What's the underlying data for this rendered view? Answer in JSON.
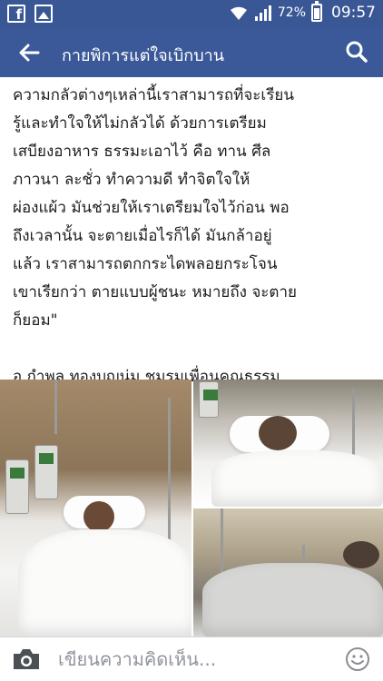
{
  "status_bar": {
    "battery_text": "72%",
    "time": "09:57",
    "icons": [
      "facebook-icon",
      "image-icon",
      "wifi-icon",
      "signal-icon",
      "battery-icon"
    ]
  },
  "app_bar": {
    "title": "กายพิการแต่ใจเบิกบาน",
    "back_icon": "arrow-left-icon",
    "search_icon": "search-icon",
    "color": "#3b5998"
  },
  "post": {
    "lines": [
      "ความกลัวต่างๆเหล่านี้เราสามารถที่จะเรียน",
      "รู้และทำใจให้ไม่กลัวได้ ด้วยการเตรียม",
      "เสบียงอาหาร ธรรมะเอาไว้ คือ ทาน ศีล",
      "ภาวนา ละชั่ว ทำความดี ทำจิตใจให้",
      "ผ่องแผ้ว มันช่วยให้เราเตรียมใจไว้ก่อน พอ",
      "ถึงเวลานั้น จะตายเมื่อไรก็ได้ มันกล้าอยู่",
      "แล้ว เราสามารถตกกระไดพลอยกระโจน",
      "เขาเรียกว่า ตายแบบผู้ชนะ หมายถึง จะตาย",
      "ก็ยอม\""
    ],
    "signature": "อ.กำพล ทองบุญนุ่ม ชมรมเพื่อนคุณธรรม"
  },
  "comment_bar": {
    "placeholder": "เขียนความคิดเห็น...",
    "camera_icon": "camera-icon",
    "emoji_icon": "smiley-icon"
  }
}
